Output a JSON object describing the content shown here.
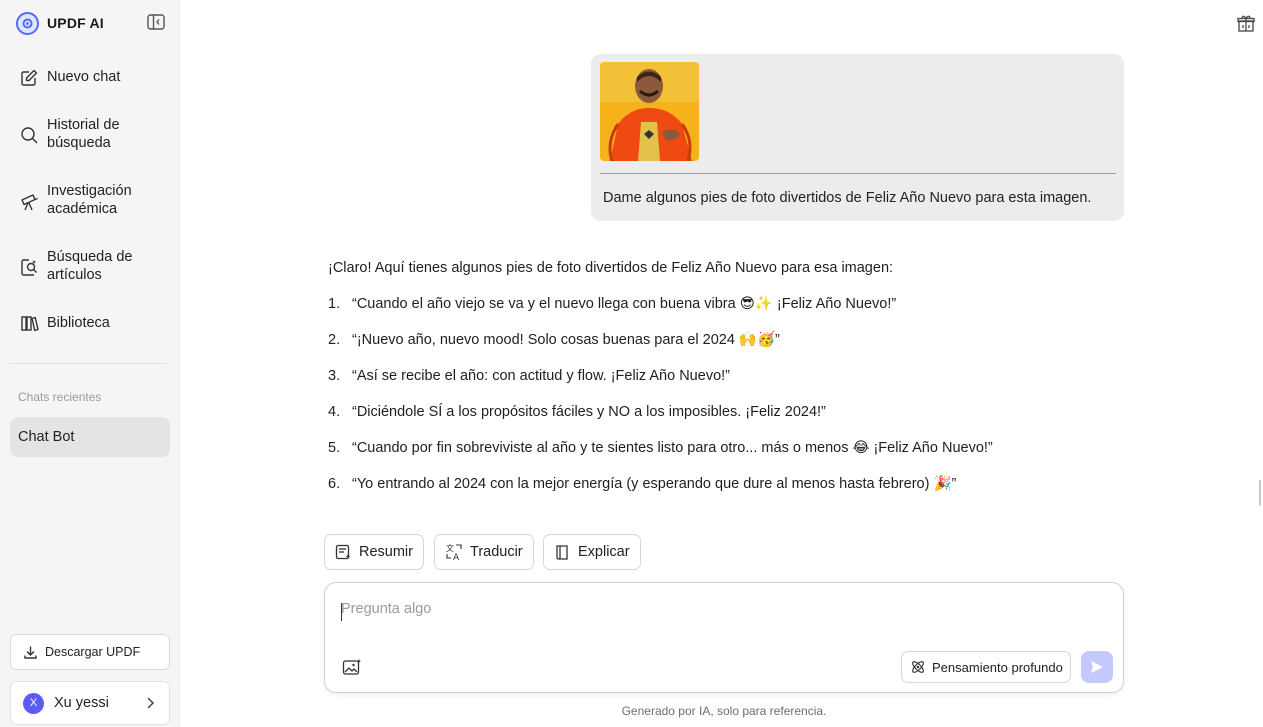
{
  "app": {
    "brand": "UPDF AI"
  },
  "sidebar": {
    "items": [
      {
        "label": "Nuevo chat",
        "icon": "edit-icon"
      },
      {
        "label": "Historial de búsqueda",
        "icon": "search-icon"
      },
      {
        "label": "Investigación académica",
        "icon": "telescope-icon"
      },
      {
        "label": "Búsqueda de artículos",
        "icon": "article-search-icon"
      },
      {
        "label": "Biblioteca",
        "icon": "library-icon"
      }
    ],
    "recent_title": "Chats recientes",
    "recent_chats": [
      {
        "label": "Chat Bot"
      }
    ],
    "download_label": "Descargar UPDF",
    "user": {
      "initial": "X",
      "name": "Xu yessi"
    }
  },
  "conversation": {
    "user_message": {
      "text": "Dame algunos pies de foto divertidos de Feliz Año Nuevo para esta imagen."
    },
    "assistant_reply": {
      "intro": "¡Claro! Aquí tienes algunos pies de foto divertidos de Feliz Año Nuevo para esa imagen:",
      "items": [
        {
          "num": "1.",
          "text": "“Cuando el año viejo se va y el nuevo llega con buena vibra 😎✨ ¡Feliz Año Nuevo!”"
        },
        {
          "num": "2.",
          "text": "“¡Nuevo año, nuevo mood! Solo cosas buenas para el 2024 🙌🥳”"
        },
        {
          "num": "3.",
          "text": "“Así se recibe el año: con actitud y flow. ¡Feliz Año Nuevo!”"
        },
        {
          "num": "4.",
          "text": "“Diciéndole SÍ a los propósitos fáciles y NO a los imposibles. ¡Feliz 2024!”"
        },
        {
          "num": "5.",
          "text": "“Cuando por fin sobreviviste al año y te sientes listo para otro... más o menos 😂 ¡Feliz Año Nuevo!”"
        },
        {
          "num": "6.",
          "text": "“Yo entrando al 2024 con la mejor energía (y esperando que dure al menos hasta febrero) 🎉”"
        }
      ]
    }
  },
  "actions": {
    "summarize": "Resumir",
    "translate": "Traducir",
    "explain": "Explicar"
  },
  "composer": {
    "placeholder": "Pregunta algo",
    "deep_thinking": "Pensamiento profundo"
  },
  "footnote": "Generado por IA, solo para referencia.",
  "colors": {
    "accent": "#4f6df5",
    "send_disabled": "#c4c9fb",
    "sidebar_bg": "#f5f5f6"
  }
}
